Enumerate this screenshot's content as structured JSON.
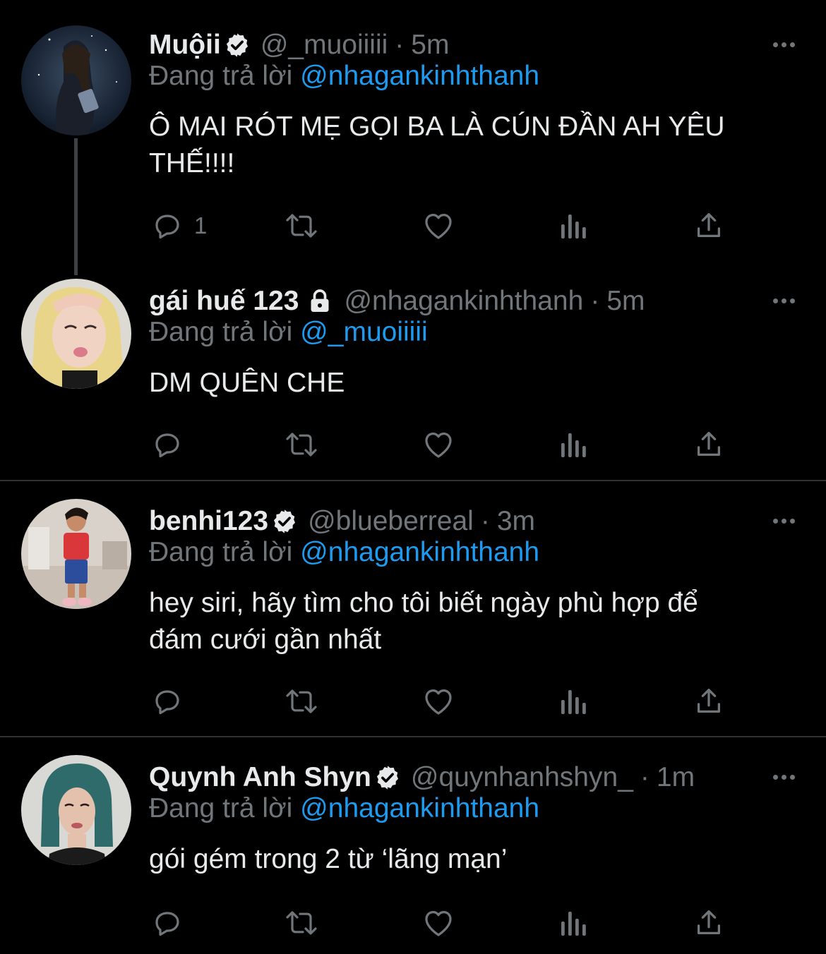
{
  "theme": {
    "background": "#000000",
    "primary_text": "#e7e9ea",
    "secondary_text": "#71767b",
    "link_color": "#1d9bf0",
    "divider": "#2f3336"
  },
  "tweets": [
    {
      "display_name": "Muộii",
      "badge": "verified-badge-icon",
      "handle": "@_muoiiiii",
      "separator": "·",
      "time": "5m",
      "replying_prefix": "Đang trả lời",
      "replying_to": "@nhagankinhthanh",
      "text_lines": [
        "Ô MAI RÓT MẸ GỌI BA LÀ CÚN ĐẦN AH YÊU",
        "THẾ!!!!"
      ],
      "reply_count": "1"
    },
    {
      "display_name": "gái huế 123",
      "badge": "lock-icon",
      "handle": "@nhagankinhthanh",
      "separator": "·",
      "time": "5m",
      "replying_prefix": "Đang trả lời",
      "replying_to": "@_muoiiiii",
      "text_lines": [
        "DM QUÊN CHE"
      ],
      "reply_count": ""
    },
    {
      "display_name": "benhi123",
      "badge": "verified-badge-icon",
      "handle": "@blueberreal",
      "separator": "·",
      "time": "3m",
      "replying_prefix": "Đang trả lời",
      "replying_to": "@nhagankinhthanh",
      "text_lines": [
        "hey siri, hãy tìm cho tôi biết ngày phù hợp để",
        "đám cưới gần nhất"
      ],
      "reply_count": ""
    },
    {
      "display_name": "Quynh Anh Shyn",
      "badge": "verified-badge-icon",
      "handle": "@quynhanhshyn_",
      "separator": "·",
      "time": "1m",
      "replying_prefix": "Đang trả lời",
      "replying_to": "@nhagankinhthanh",
      "text_lines": [
        "gói gém trong 2 từ ‘lãng mạn’"
      ],
      "reply_count": ""
    }
  ]
}
